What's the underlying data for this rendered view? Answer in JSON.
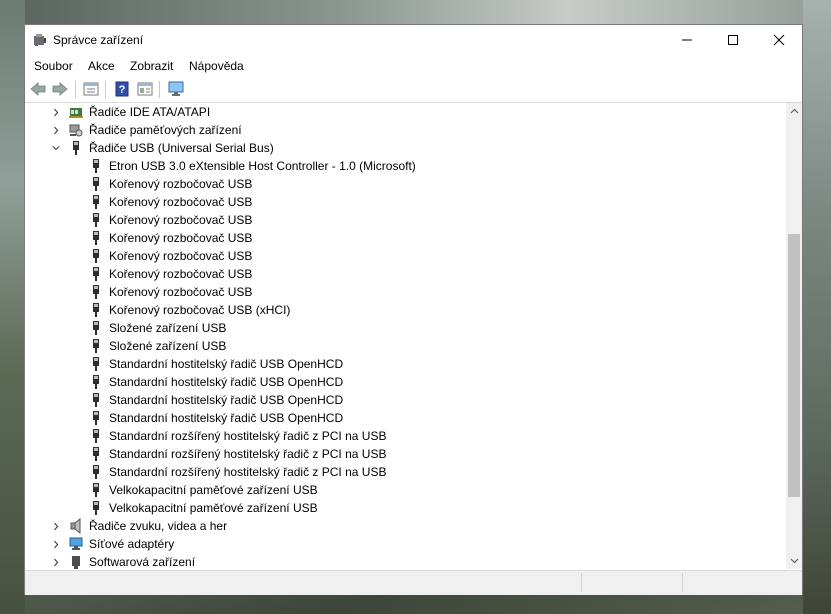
{
  "window": {
    "title": "Správce zařízení"
  },
  "menu": [
    "Soubor",
    "Akce",
    "Zobrazit",
    "Nápověda"
  ],
  "toolbar": {
    "buttons": [
      "back-icon",
      "forward-icon",
      "properties-icon",
      "help-icon",
      "view-icon",
      "monitor-icon"
    ]
  },
  "tree": {
    "categories_top": [
      {
        "label": "Řadiče IDE ATA/ATAPI",
        "icon": "ide-controller-icon",
        "expanded": false
      },
      {
        "label": "Řadiče paměťových zařízení",
        "icon": "storage-controller-icon",
        "expanded": false
      },
      {
        "label": "Řadiče USB (Universal Serial Bus)",
        "icon": "usb-icon",
        "expanded": true
      }
    ],
    "usb_children": [
      "Etron USB 3.0 eXtensible Host Controller - 1.0 (Microsoft)",
      "Kořenový rozbočovač USB",
      "Kořenový rozbočovač USB",
      "Kořenový rozbočovač USB",
      "Kořenový rozbočovač USB",
      "Kořenový rozbočovač USB",
      "Kořenový rozbočovač USB",
      "Kořenový rozbočovač USB",
      "Kořenový rozbočovač USB (xHCI)",
      "Složené zařízení USB",
      "Složené zařízení USB",
      "Standardní hostitelský řadič  USB OpenHCD",
      "Standardní hostitelský řadič  USB OpenHCD",
      "Standardní hostitelský řadič  USB OpenHCD",
      "Standardní hostitelský řadič  USB OpenHCD",
      "Standardní rozšířený hostitelský řadič z PCI na USB",
      "Standardní rozšířený hostitelský řadič z PCI na USB",
      "Standardní rozšířený hostitelský řadič z PCI na USB",
      "Velkokapacitní paměťové zařízení USB",
      "Velkokapacitní paměťové zařízení USB"
    ],
    "categories_bottom": [
      {
        "label": "Řadiče zvuku, videa a her",
        "icon": "speaker-icon",
        "expanded": false
      },
      {
        "label": "Síťové adaptéry",
        "icon": "network-adapter-icon",
        "expanded": false
      },
      {
        "label": "Softwarová zařízení",
        "icon": "software-device-icon",
        "expanded": false
      }
    ]
  },
  "colors": {
    "selection": "#cce8ff",
    "scroll_thumb": "#c1c1c1",
    "window_border": "#7a7a7a"
  }
}
